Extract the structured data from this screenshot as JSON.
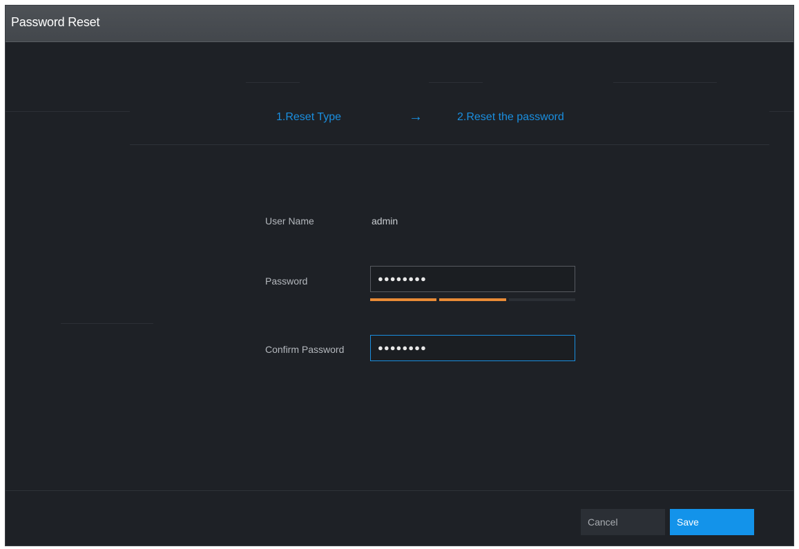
{
  "dialog": {
    "title": "Password Reset"
  },
  "steps": [
    {
      "label": "1.Reset Type"
    },
    {
      "label": "2.Reset the password"
    }
  ],
  "arrow_glyph": "→",
  "form": {
    "username_label": "User Name",
    "username_value": "admin",
    "password_label": "Password",
    "password_value": "●●●●●●●●",
    "password_strength": {
      "filled_segments": 2,
      "total_segments": 3,
      "color": "#e98b36"
    },
    "confirm_label": "Confirm Password",
    "confirm_value": "●●●●●●●●"
  },
  "buttons": {
    "cancel": "Cancel",
    "save": "Save"
  },
  "colors": {
    "accent": "#1a8fe0",
    "save_button": "#1393ea",
    "background": "#1e2126"
  }
}
